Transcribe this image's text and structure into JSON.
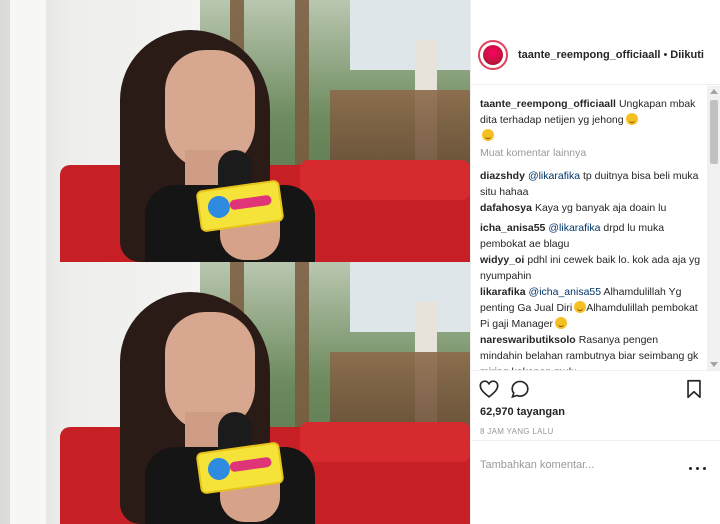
{
  "post": {
    "username": "taante_reempong_officiaall",
    "separator": "•",
    "follow_status": "Diikuti",
    "caption": {
      "user": "taante_reempong_officiaall",
      "text": "Ungkapan mbak dita terhadap netijen yg jehong"
    },
    "load_more": "Muat komentar lainnya",
    "comments": [
      {
        "user": "diazshdy",
        "mention": "@likarafika",
        "text": "tp duitnya bisa beli muka situ hahaa"
      },
      {
        "user": "dafahosya",
        "mention": "",
        "text": "Kaya yg banyak aja doain lu"
      },
      {
        "user": "icha_anisa55",
        "mention": "@likarafika",
        "text": "drpd lu muka pembokat ae blagu"
      },
      {
        "user": "widyy_oi",
        "mention": "",
        "text": "pdhl ini cewek baik lo. kok ada aja yg nyumpahin"
      },
      {
        "user": "likarafika",
        "mention": "@icha_anisa55",
        "text": "Alhamdulillah Yg penting Ga Jual Diri",
        "text2": "Alhamdulillah pembokat Pi gaji Manager"
      },
      {
        "user": "nareswaributiksolo",
        "mention": "",
        "text": "Rasanya pengen mindahin belahan rambutnya biar seimbang gk miring kekanan mulu"
      }
    ],
    "views": "62,970 tayangan",
    "time_ago": "8 JAM YANG LALU",
    "add_comment_placeholder": "Tambahkan komentar..."
  },
  "icons": {
    "avatar": "profile-avatar",
    "like": "heart-icon",
    "comment": "comment-bubble-icon",
    "save": "bookmark-icon",
    "more": "more-options-icon"
  },
  "colors": {
    "mention": "#003569",
    "muted": "#999999",
    "text": "#262626"
  }
}
